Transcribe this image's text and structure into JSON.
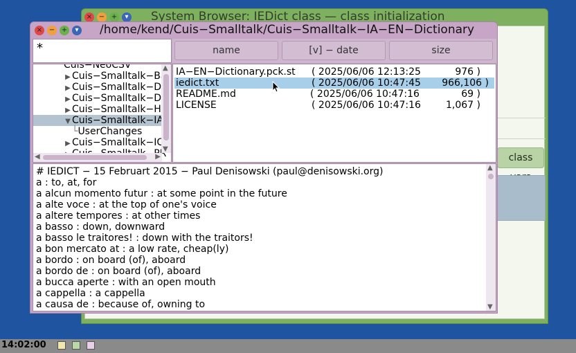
{
  "back_window": {
    "title": "System Browser: IEDict class — class initialization",
    "class_vars_label": "class vars"
  },
  "front_window": {
    "title": "/home/kend/Cuis−Smalltalk/Cuis−Smalltalk−IA−EN−Dictionary",
    "filter": "*",
    "tree": [
      {
        "label": "Cuis−NeoCSV",
        "arrow": ""
      },
      {
        "label": "Cuis−Smalltalk−Ba",
        "arrow": "▶"
      },
      {
        "label": "Cuis−Smalltalk−De",
        "arrow": "▶"
      },
      {
        "label": "Cuis−Smalltalk−De",
        "arrow": "▶"
      },
      {
        "label": "Cuis−Smalltalk−Hi",
        "arrow": "▶"
      },
      {
        "label": "Cuis−Smalltalk−IA",
        "arrow": "▼"
      },
      {
        "label": "UserChanges",
        "arrow": ""
      },
      {
        "label": "Cuis−Smalltalk−IC",
        "arrow": "▶"
      },
      {
        "label": "Cuis−Smalltalk−PR",
        "arrow": "▶"
      }
    ],
    "columns": {
      "name": "name",
      "date": "[v] − date",
      "size": "size"
    },
    "files": [
      {
        "name": "IA−EN−Dictionary.pck.st",
        "date": "( 2025/06/06  12:13:25",
        "size": "976 )"
      },
      {
        "name": "iedict.txt",
        "date": "( 2025/06/06  10:47:45",
        "size": "966,106 )"
      },
      {
        "name": "README.md",
        "date": "( 2025/06/06  10:47:16",
        "size": "69 )"
      },
      {
        "name": "LICENSE",
        "date": "( 2025/06/06  10:47:16",
        "size": "1,067 )"
      }
    ],
    "text_lines": [
      "# IEDICT − 15 Februart 2015 − Paul Denisowski (paul@denisowski.org)",
      "a : to, at, for",
      "a alcun momento futur : at some point in the future",
      "a alte voce : at the top of one's voice",
      "a altere tempores : at other times",
      "a basso : down, downward",
      "a basso le traitores! : down with the traitors!",
      "a bon mercato at : a low rate, cheap(ly)",
      "a bordo : on board (of), aboard",
      "a bordo de : on board (of), aboard",
      "a bucca aperte : with an open mouth",
      "a cappella : a cappella",
      "a causa de : because of, owning to"
    ]
  },
  "taskbar": {
    "clock": "14:02:00"
  }
}
